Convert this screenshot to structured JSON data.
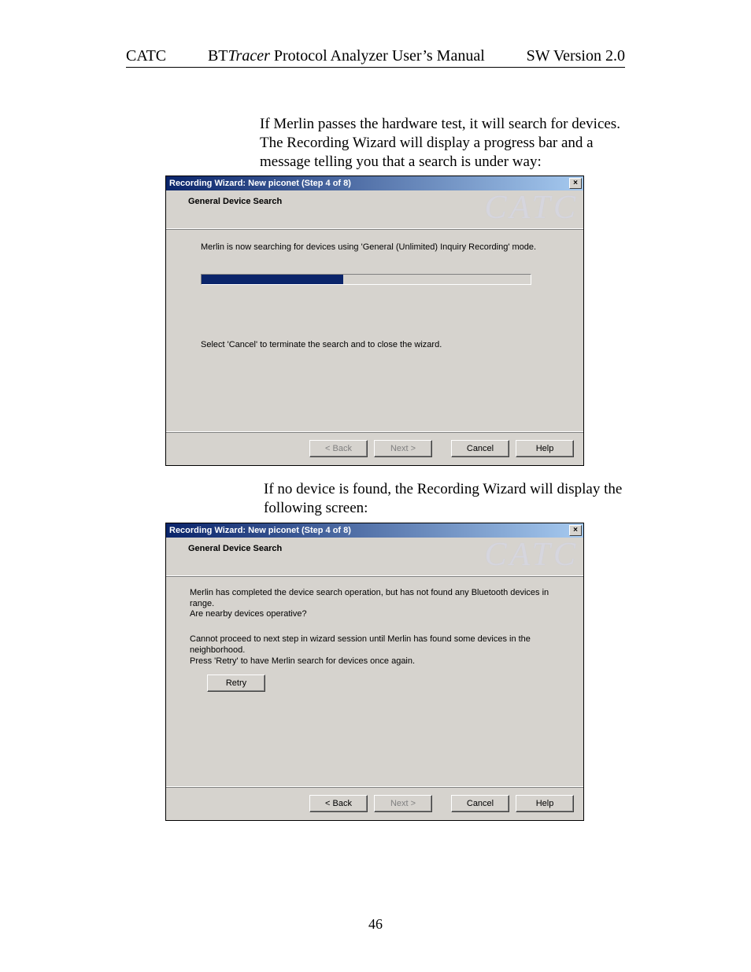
{
  "header": {
    "left": "CATC",
    "center_prefix": "BT",
    "center_italic": "Tracer",
    "center_suffix": " Protocol Analyzer User’s Manual",
    "right": "SW Version 2.0"
  },
  "para1": "If Merlin passes the hardware test, it will search for devices.  The Recording Wizard will display a progress bar and a message telling you that a search is under way:",
  "para2": " If no device is found, the Recording Wizard will display the following screen:",
  "dialog1": {
    "title": "Recording Wizard: New piconet (Step 4 of 8)",
    "close": "×",
    "section": "General Device Search",
    "watermark": "CATC",
    "msg": "Merlin is now searching for devices using 'General (Unlimited) Inquiry Recording' mode.",
    "hint": "Select 'Cancel' to terminate the search and to close the wizard.",
    "progress_percent": 43,
    "buttons": {
      "back": "< Back",
      "next": "Next >",
      "cancel": "Cancel",
      "help": "Help"
    }
  },
  "dialog2": {
    "title": "Recording Wizard: New piconet (Step 4 of 8)",
    "close": "×",
    "section": "General Device Search",
    "watermark": "CATC",
    "msg1": "Merlin has completed the device search operation, but has not found any Bluetooth devices in range.\nAre nearby devices operative?",
    "msg2": "Cannot proceed to next step in wizard session until Merlin has found some devices in the neighborhood.\nPress 'Retry' to have Merlin search for devices once again.",
    "retry": "Retry",
    "buttons": {
      "back": "< Back",
      "next": "Next >",
      "cancel": "Cancel",
      "help": "Help"
    }
  },
  "page_number": "46"
}
